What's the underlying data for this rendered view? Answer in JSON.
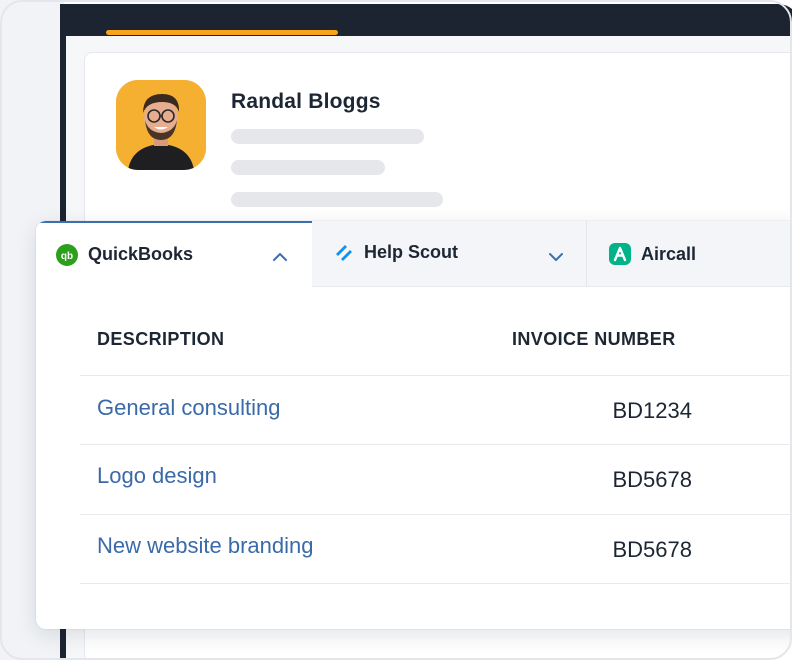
{
  "profile": {
    "name": "Randal Bloggs",
    "avatar_bg": "#f5b032"
  },
  "tabs": [
    {
      "label": "QuickBooks",
      "icon": "quickbooks-icon",
      "icon_color": "#2ca01c",
      "expanded": true
    },
    {
      "label": "Help Scout",
      "icon": "help-scout-icon",
      "icon_color": "#1292ee",
      "expanded": false
    },
    {
      "label": "Aircall",
      "icon": "aircall-icon",
      "icon_color": "#00b388"
    }
  ],
  "table": {
    "headers": [
      "DESCRIPTION",
      "INVOICE NUMBER"
    ],
    "rows": [
      {
        "description": "General consulting",
        "invoice_number": "BD1234"
      },
      {
        "description": "Logo design",
        "invoice_number": "BD5678"
      },
      {
        "description": "New website branding",
        "invoice_number": "BD5678"
      }
    ]
  },
  "colors": {
    "accent": "#f7a31c",
    "link": "#3a6aa8",
    "text": "#1d2633",
    "window_dark": "#1c2431"
  }
}
